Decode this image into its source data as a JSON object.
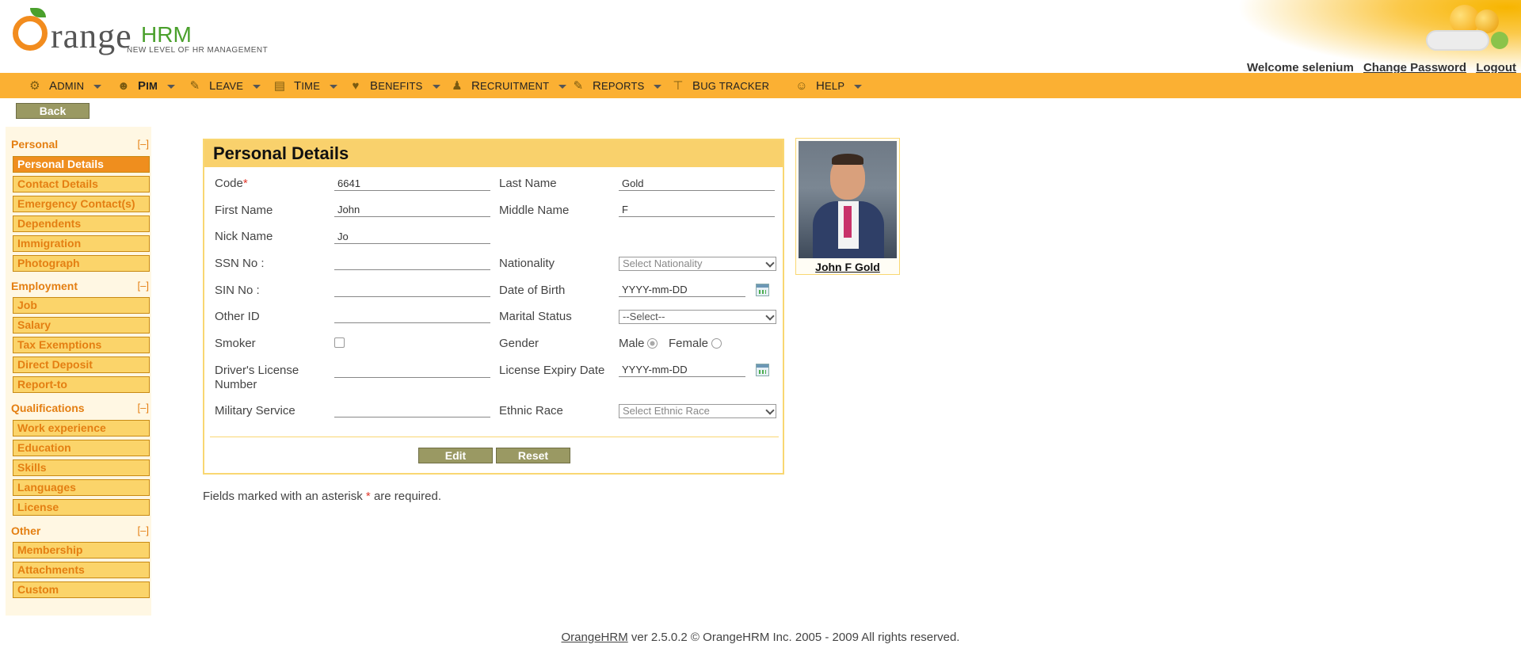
{
  "logo": {
    "word": "range",
    "hrm": "HRM",
    "tagline": "NEW LEVEL OF HR MANAGEMENT"
  },
  "user": {
    "welcome": "Welcome selenium",
    "change_password": "Change Password",
    "logout": "Logout"
  },
  "menu": [
    {
      "label": "Admin",
      "icon": "admin-icon"
    },
    {
      "label": "PIM",
      "icon": "pim-icon"
    },
    {
      "label": "Leave",
      "icon": "leave-icon"
    },
    {
      "label": "Time",
      "icon": "time-icon"
    },
    {
      "label": "Benefits",
      "icon": "benefits-icon"
    },
    {
      "label": "Recruitment",
      "icon": "recruitment-icon"
    },
    {
      "label": "Reports",
      "icon": "reports-icon"
    },
    {
      "label": "Bug Tracker",
      "icon": "bug-tracker-icon"
    },
    {
      "label": "Help",
      "icon": "help-icon"
    }
  ],
  "back_label": "Back",
  "nav": {
    "toggle": "[–]",
    "personal": {
      "title": "Personal",
      "items": [
        "Personal Details",
        "Contact Details",
        "Emergency Contact(s)",
        "Dependents",
        "Immigration",
        "Photograph"
      ]
    },
    "employment": {
      "title": "Employment",
      "items": [
        "Job",
        "Salary",
        "Tax Exemptions",
        "Direct Deposit",
        "Report-to"
      ]
    },
    "qualifications": {
      "title": "Qualifications",
      "items": [
        "Work experience",
        "Education",
        "Skills",
        "Languages",
        "License"
      ]
    },
    "other": {
      "title": "Other",
      "items": [
        "Membership",
        "Attachments",
        "Custom"
      ]
    }
  },
  "form": {
    "title": "Personal Details",
    "code_label": "Code",
    "required_mark": "*",
    "code_value": "6641",
    "last_name_label": "Last Name",
    "last_name_value": "Gold",
    "first_name_label": "First Name",
    "first_name_value": "John",
    "middle_name_label": "Middle Name",
    "middle_name_value": "F",
    "nick_name_label": "Nick Name",
    "nick_name_value": "Jo",
    "ssn_label": "SSN No :",
    "ssn_value": "",
    "nationality_label": "Nationality",
    "nationality_value": "Select Nationality",
    "sin_label": "SIN No :",
    "sin_value": "",
    "dob_label": "Date of Birth",
    "dob_value": "YYYY-mm-DD",
    "other_id_label": "Other ID",
    "other_id_value": "",
    "marital_label": "Marital Status",
    "marital_value": "--Select--",
    "smoker_label": "Smoker",
    "gender_label": "Gender",
    "male_label": "Male",
    "female_label": "Female",
    "dl_label_line1": "Driver's License",
    "dl_label_line2": "Number",
    "dl_value": "",
    "license_expiry_label": "License Expiry Date",
    "license_expiry_value": "YYYY-mm-DD",
    "military_label": "Military Service",
    "military_value": "",
    "ethnic_label": "Ethnic Race",
    "ethnic_value": "Select Ethnic Race",
    "edit_label": "Edit",
    "reset_label": "Reset"
  },
  "required_note": {
    "before": "Fields marked with an asterisk",
    "mark": "*",
    "after": "are required."
  },
  "photo": {
    "name": "John F Gold"
  },
  "footer": {
    "link": "OrangeHRM",
    "text": "ver 2.5.0.2 © OrangeHRM Inc. 2005 - 2009 All rights reserved."
  },
  "colors": {
    "menu_bar": "#fbb033",
    "nav_item": "#fbd46a",
    "nav_active": "#ef8e1e",
    "accent_text": "#e47f12",
    "button": "#9a9963",
    "panel_header": "#f9d16c"
  }
}
